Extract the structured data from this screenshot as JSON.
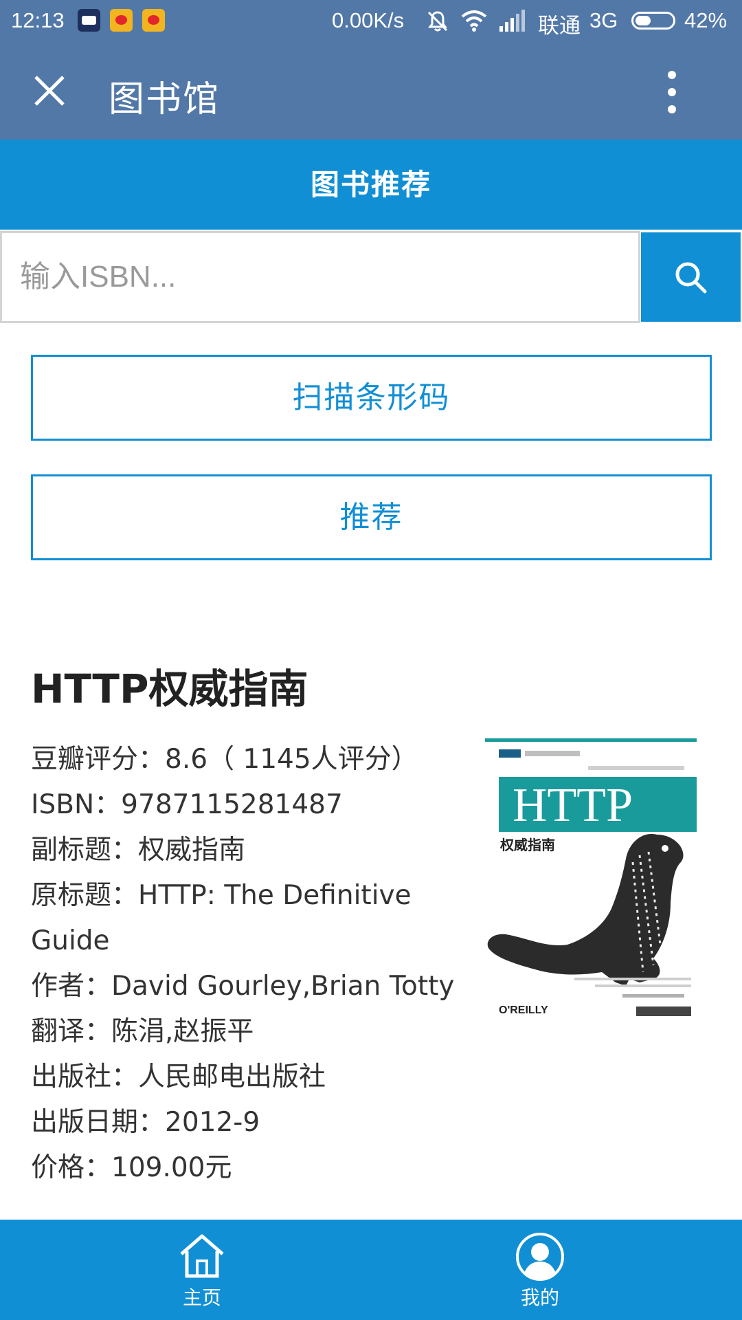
{
  "status_bar": {
    "time": "12:13",
    "network_speed": "0.00K/s",
    "carrier": "联通",
    "network_type": "3G",
    "battery_percent": "42%",
    "battery_level": 0.42,
    "icons": [
      "notification-app-icon",
      "weibo-icon",
      "weibo-icon",
      "mute-icon",
      "wifi-icon",
      "signal-icon",
      "battery-icon"
    ]
  },
  "titlebar": {
    "title": "图书馆",
    "close_icon": "close-icon",
    "menu_icon": "more-vertical-icon"
  },
  "header": {
    "title": "图书推荐"
  },
  "search": {
    "placeholder": "输入ISBN...",
    "value": "",
    "button_icon": "search-icon"
  },
  "actions": {
    "scan_label": "扫描条形码",
    "recommend_label": "推荐"
  },
  "book": {
    "title": "HTTP权威指南",
    "details": [
      "豆瓣评分：8.6（ 1145人评分）",
      "ISBN：9787115281487",
      "副标题：权威指南",
      "原标题：HTTP: The Definitive Guide",
      "作者：David Gourley,Brian Totty",
      "翻译：陈涓,赵振平",
      "出版社：人民邮电出版社",
      "出版日期：2012-9",
      "价格：109.00元"
    ],
    "cover": {
      "title": "HTTP",
      "subtitle": "权威指南",
      "publisher": "O'REILLY",
      "accent_color": "#1a9b9b"
    }
  },
  "tabbar": {
    "home_label": "主页",
    "me_label": "我的"
  },
  "colors": {
    "title_bar": "#5278a8",
    "primary": "#118fd4",
    "text": "#333333"
  }
}
